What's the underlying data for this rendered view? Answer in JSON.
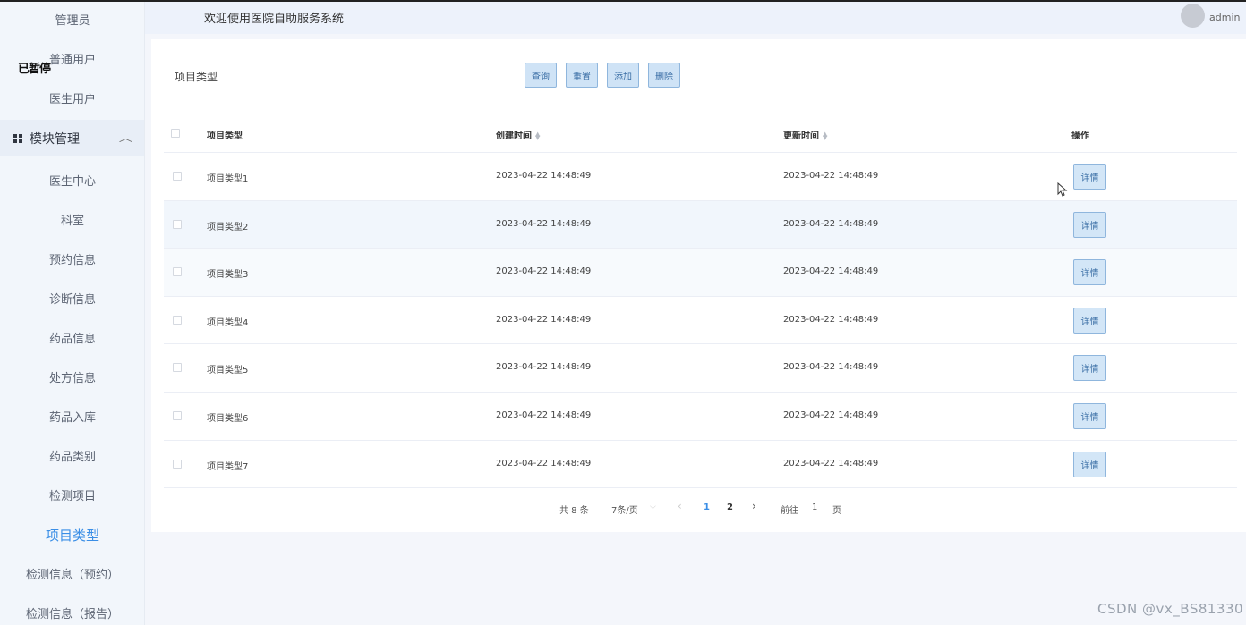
{
  "sidebar": {
    "items_top": [
      {
        "label": "管理员"
      },
      {
        "label": "普通用户"
      },
      {
        "label": "医生用户"
      }
    ],
    "overlay_text": "已暂停",
    "group": {
      "label": "模块管理",
      "icon": "grid-icon",
      "chevron": "chevron-up-icon"
    },
    "items": [
      {
        "label": "医生中心"
      },
      {
        "label": "科室"
      },
      {
        "label": "预约信息"
      },
      {
        "label": "诊断信息"
      },
      {
        "label": "药品信息"
      },
      {
        "label": "处方信息"
      },
      {
        "label": "药品入库"
      },
      {
        "label": "药品类别"
      },
      {
        "label": "检测项目"
      },
      {
        "label": "项目类型"
      },
      {
        "label": "检测信息（预约）"
      },
      {
        "label": "检测信息（报告）"
      }
    ],
    "active_item": "项目类型"
  },
  "header": {
    "title": "欢迎使用医院自助服务系统",
    "user": "admin"
  },
  "search": {
    "label": "项目类型",
    "value": "",
    "placeholder": "",
    "buttons": {
      "query": "查询",
      "reset": "重置",
      "add": "添加",
      "delete": "删除"
    }
  },
  "table": {
    "columns": {
      "type": "项目类型",
      "created": "创建时间",
      "updated": "更新时间",
      "action": "操作"
    },
    "rows": [
      {
        "type": "项目类型1",
        "created": "2023-04-22 14:48:49",
        "updated": "2023-04-22 14:48:49",
        "action": "详情"
      },
      {
        "type": "项目类型2",
        "created": "2023-04-22 14:48:49",
        "updated": "2023-04-22 14:48:49",
        "action": "详情"
      },
      {
        "type": "项目类型3",
        "created": "2023-04-22 14:48:49",
        "updated": "2023-04-22 14:48:49",
        "action": "详情"
      },
      {
        "type": "项目类型4",
        "created": "2023-04-22 14:48:49",
        "updated": "2023-04-22 14:48:49",
        "action": "详情"
      },
      {
        "type": "项目类型5",
        "created": "2023-04-22 14:48:49",
        "updated": "2023-04-22 14:48:49",
        "action": "详情"
      },
      {
        "type": "项目类型6",
        "created": "2023-04-22 14:48:49",
        "updated": "2023-04-22 14:48:49",
        "action": "详情"
      },
      {
        "type": "项目类型7",
        "created": "2023-04-22 14:48:49",
        "updated": "2023-04-22 14:48:49",
        "action": "详情"
      }
    ]
  },
  "pagination": {
    "total": "共 8 条",
    "page_size": "7条/页",
    "pages": [
      "1",
      "2"
    ],
    "current_page": "1",
    "goto_prefix": "前往",
    "goto_value": "1",
    "goto_suffix": "页"
  },
  "watermark": "CSDN @vx_BS81330",
  "colors": {
    "accent": "#3a8ee6",
    "button_bg": "#cfe3f6",
    "sidebar_bg": "#f2f6fb"
  }
}
